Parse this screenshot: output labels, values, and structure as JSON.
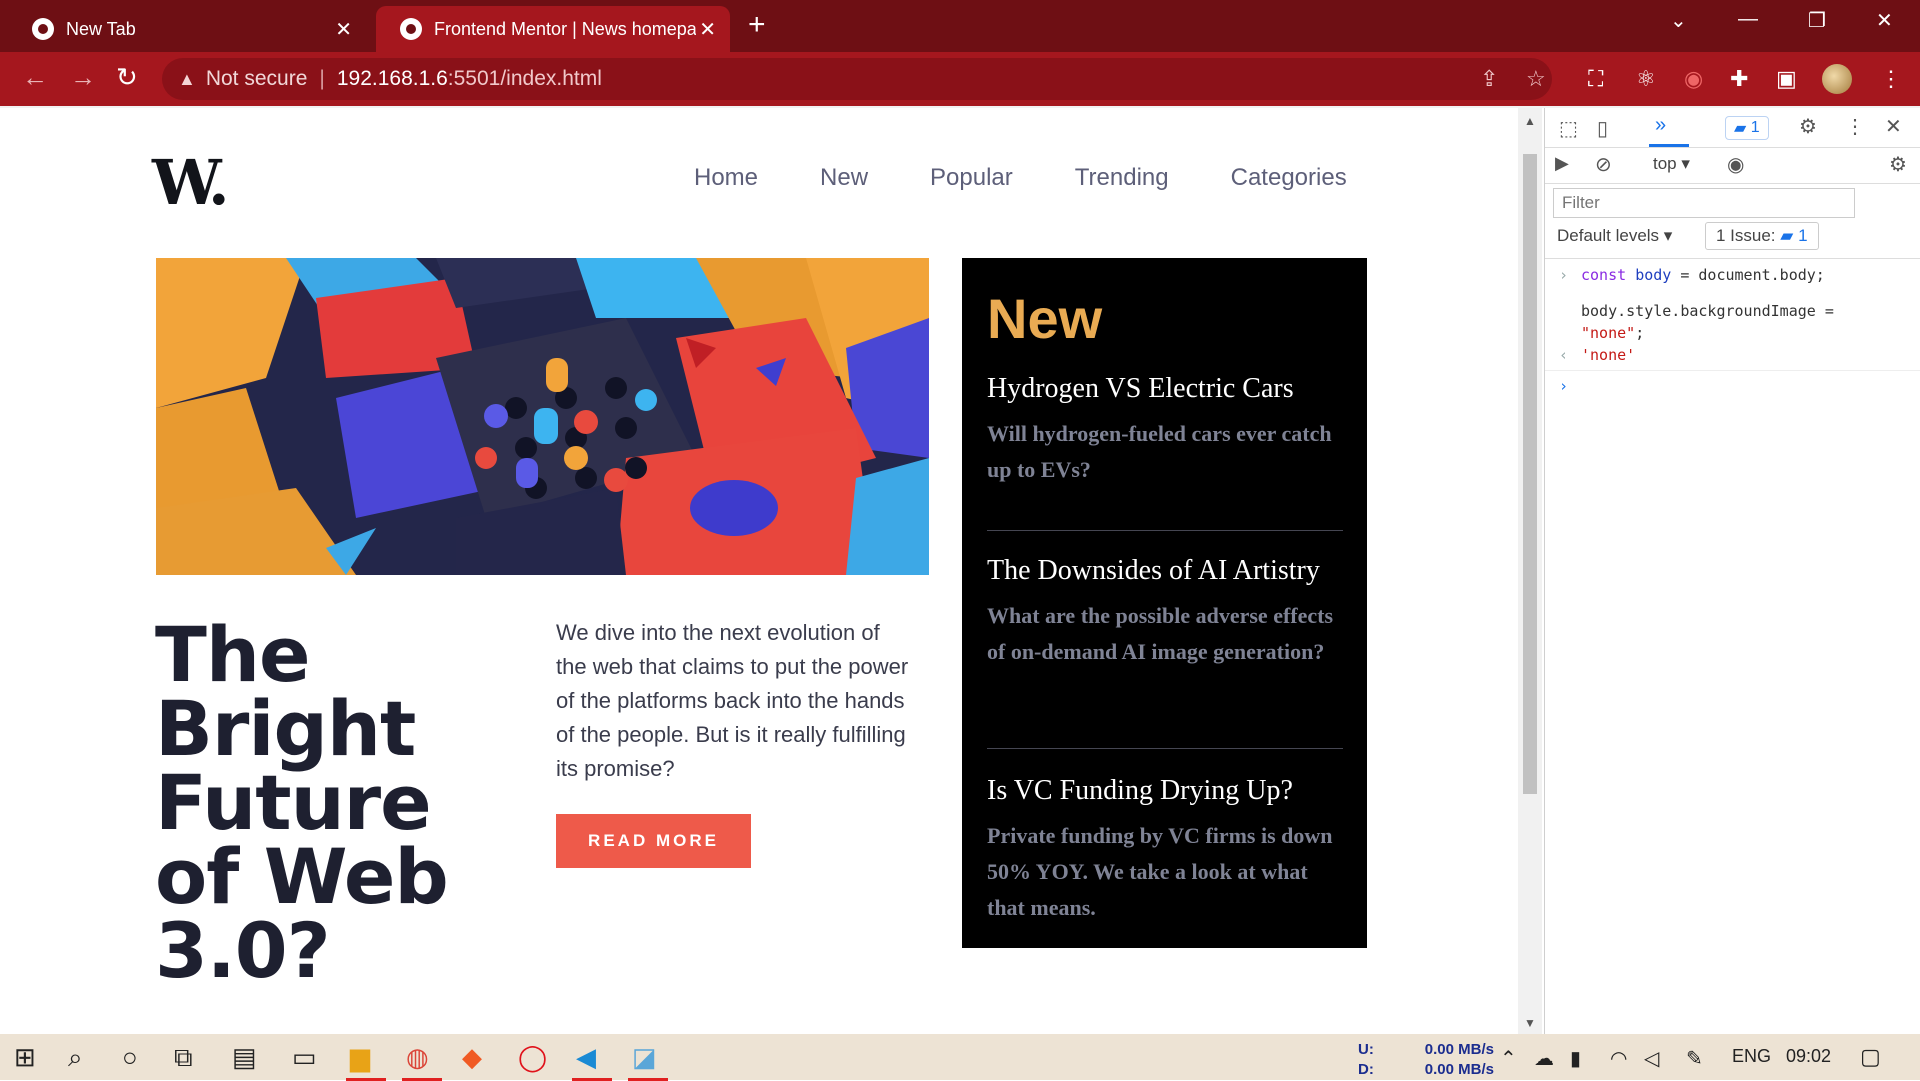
{
  "browser": {
    "tabs": [
      {
        "title": "New Tab",
        "active": false
      },
      {
        "title": "Frontend Mentor | News homepage",
        "active": true
      }
    ],
    "address": {
      "security": "Not secure",
      "host": "192.168.1.6",
      "path": ":5501/index.html"
    }
  },
  "page": {
    "logo": "W.",
    "nav": [
      "Home",
      "New",
      "Popular",
      "Trending",
      "Categories"
    ],
    "headline": "The Bright Future of Web 3.0?",
    "blurb": "We dive into the next evolution of the web that claims to put the power of the platforms back into the hands of the people. But is it really fulfilling its promise?",
    "cta": "READ MORE",
    "new_section": {
      "heading": "New",
      "items": [
        {
          "title": "Hydrogen VS Electric Cars",
          "desc": "Will hydrogen-fueled cars ever catch up to EVs?"
        },
        {
          "title": "The Downsides of AI Artistry",
          "desc": "What are the possible adverse effects of on-demand AI image generation?"
        },
        {
          "title": "Is VC Funding Drying Up?",
          "desc": "Private funding by VC firms is down 50% YOY. We take a look at what that means."
        }
      ]
    },
    "colors": {
      "accent": "#ee5a4a",
      "new_heading": "#e9ab53",
      "dark": "#000000"
    }
  },
  "devtools": {
    "issues_count": "1",
    "context": "top",
    "filter_placeholder": "Filter",
    "levels": "Default levels",
    "issues_label": "1 Issue:",
    "issues_badge": "1",
    "console": {
      "line1_kw": "const",
      "line1_var": "body",
      "line1_rest": " = document.body;",
      "line2": "body.style.backgroundImage =",
      "line3_str": "\"none\"",
      "line3_rest": ";",
      "result": "'none'"
    }
  },
  "taskbar": {
    "net_labels": [
      "U:",
      "D:"
    ],
    "net_values": [
      "0.00 MB/s",
      "0.00 MB/s"
    ],
    "lang": "ENG",
    "time": "09:02"
  }
}
